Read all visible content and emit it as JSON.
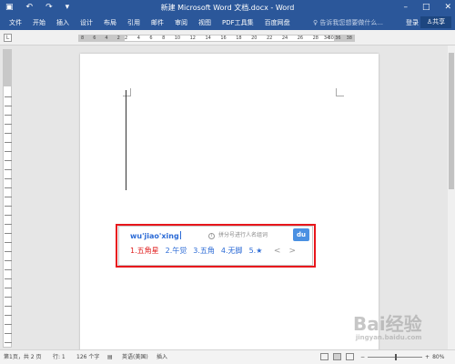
{
  "titlebar": {
    "save_icon": "save-icon",
    "undo_icon": "undo-icon",
    "redo_icon": "redo-icon",
    "customize_icon": "dropdown-icon",
    "title": "新建 Microsoft Word 文档.docx - Word",
    "minimize": "–",
    "restore": "□",
    "close": "✕"
  },
  "ribbon": {
    "tabs": [
      "文件",
      "开始",
      "插入",
      "设计",
      "布局",
      "引用",
      "邮件",
      "审阅",
      "视图",
      "PDF工具集",
      "百度网盘"
    ],
    "tell_me": "告诉我您想要做什么...",
    "login": "登录",
    "share": "共享"
  },
  "ruler": {
    "corner": "L",
    "left_numbers": [
      "8",
      "6",
      "4",
      "2"
    ],
    "numbers": [
      "2",
      "4",
      "6",
      "8",
      "10",
      "12",
      "14",
      "16",
      "18",
      "20",
      "22",
      "24",
      "26",
      "28",
      "30"
    ],
    "right_numbers": [
      "34",
      "36",
      "38"
    ]
  },
  "ime": {
    "pinyin": "wu'jiao'xing",
    "hint_icon": "i",
    "hint": "拼分号进行人名组词",
    "logo": "du",
    "candidates": [
      "1.五角星",
      "2.午觉",
      "3.五角",
      "4.无脚",
      "5.★"
    ],
    "prev": "<",
    "next": ">"
  },
  "status": {
    "page": "第1页，共 2 页",
    "line": "行: 1",
    "words": "126 个字",
    "proof_icon": "proofing-icon",
    "language": "英语(美国)",
    "mode": "插入",
    "zoom_minus": "−",
    "zoom_plus": "+",
    "zoom": "80%"
  },
  "watermark": {
    "text": "Bai经验",
    "sub": "jingyan.baidu.com"
  }
}
